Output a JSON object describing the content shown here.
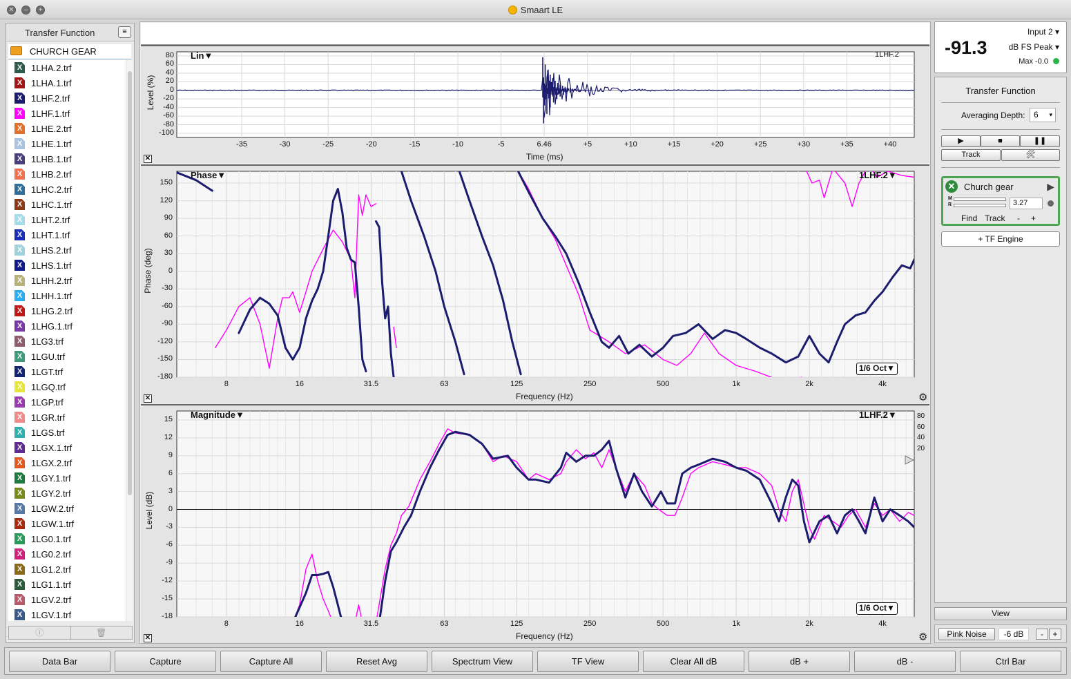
{
  "window": {
    "title": "Smaart LE"
  },
  "sidebar": {
    "title": "Transfer Function",
    "folder": "CHURCH GEAR",
    "files": [
      {
        "name": "1LHA.2.trf",
        "color": "#2e5a4a"
      },
      {
        "name": "1LHA.1.trf",
        "color": "#a31515"
      },
      {
        "name": "1LHF.2.trf",
        "color": "#1c1c6e"
      },
      {
        "name": "1LHF.1.trf",
        "color": "#ff00ff"
      },
      {
        "name": "1LHE.2.trf",
        "color": "#e0702a"
      },
      {
        "name": "1LHE.1.trf",
        "color": "#a8c4e0"
      },
      {
        "name": "1LHB.1.trf",
        "color": "#4a3e7a"
      },
      {
        "name": "1LHB.2.trf",
        "color": "#f07050"
      },
      {
        "name": "1LHC.2.trf",
        "color": "#2f6f9a"
      },
      {
        "name": "1LHC.1.trf",
        "color": "#8a3a16"
      },
      {
        "name": "1LHT.2.trf",
        "color": "#a4dbe8"
      },
      {
        "name": "1LHT.1.trf",
        "color": "#1a2fb8"
      },
      {
        "name": "1LHS.2.trf",
        "color": "#9fd2dc"
      },
      {
        "name": "1LHS.1.trf",
        "color": "#101a8a"
      },
      {
        "name": "1LHH.2.trf",
        "color": "#b9b27a"
      },
      {
        "name": "1LHH.1.trf",
        "color": "#2aaef0"
      },
      {
        "name": "1LHG.2.trf",
        "color": "#c01818"
      },
      {
        "name": "1LHG.1.trf",
        "color": "#7a3aa6"
      },
      {
        "name": "1LG3.trf",
        "color": "#8e5c6a"
      },
      {
        "name": "1LGU.trf",
        "color": "#3e9a78"
      },
      {
        "name": "1LGT.trf",
        "color": "#132472"
      },
      {
        "name": "1LGQ.trf",
        "color": "#e5e53a"
      },
      {
        "name": "1LGP.trf",
        "color": "#9a3ab0"
      },
      {
        "name": "1LGR.trf",
        "color": "#f08a8a"
      },
      {
        "name": "1LGS.trf",
        "color": "#2eb0ae"
      },
      {
        "name": "1LGX.1.trf",
        "color": "#5e2b8e"
      },
      {
        "name": "1LGX.2.trf",
        "color": "#e25a20"
      },
      {
        "name": "1LGY.1.trf",
        "color": "#1e7a3e"
      },
      {
        "name": "1LGY.2.trf",
        "color": "#7a8a1a"
      },
      {
        "name": "1LGW.2.trf",
        "color": "#5878a8"
      },
      {
        "name": "1LGW.1.trf",
        "color": "#a82a10"
      },
      {
        "name": "1LG0.1.trf",
        "color": "#2a9a5a"
      },
      {
        "name": "1LG0.2.trf",
        "color": "#d0207a"
      },
      {
        "name": "1LG1.2.trf",
        "color": "#8a6a1a"
      },
      {
        "name": "1LG1.1.trf",
        "color": "#2a5a3a"
      },
      {
        "name": "1LGV.2.trf",
        "color": "#b85a6a"
      },
      {
        "name": "1LGV.1.trf",
        "color": "#3a5a8a"
      }
    ]
  },
  "impulse": {
    "mode_label": "Lin▼",
    "trace_label": "1LHF.2",
    "ylabel": "Level (%)",
    "xlabel": "Time (ms)",
    "yticks": [
      "80",
      "60",
      "40",
      "20",
      "0",
      "-20",
      "-40",
      "-60",
      "-80",
      "-100"
    ],
    "xticks": [
      "-35",
      "-30",
      "-25",
      "-20",
      "-15",
      "-10",
      "-5",
      "6.46",
      "+5",
      "+10",
      "+15",
      "+20",
      "+25",
      "+30",
      "+35",
      "+40"
    ]
  },
  "phase": {
    "mode_label": "Phase▼",
    "trace_label": "1LHF.2▼",
    "ylabel": "Phase (deg)",
    "xlabel": "Frequency (Hz)",
    "smoothing": "1/6 Oct▼",
    "yticks": [
      "150",
      "120",
      "90",
      "60",
      "30",
      "0",
      "-30",
      "-60",
      "-90",
      "-120",
      "-150",
      "-180"
    ],
    "xticks": [
      "8",
      "16",
      "31.5",
      "63",
      "125",
      "250",
      "500",
      "1k",
      "2k",
      "4k"
    ]
  },
  "magnitude": {
    "mode_label": "Magnitude▼",
    "trace_label": "1LHF.2▼",
    "ylabel": "Level (dB)",
    "xlabel": "Frequency (Hz)",
    "smoothing": "1/6 Oct▼",
    "yticks": [
      "15",
      "12",
      "9",
      "6",
      "3",
      "0",
      "-3",
      "-6",
      "-9",
      "-12",
      "-15",
      "-18"
    ],
    "xticks": [
      "8",
      "16",
      "31.5",
      "63",
      "125",
      "250",
      "500",
      "1k",
      "2k",
      "4k"
    ],
    "coherence_ticks": [
      "80",
      "60",
      "40",
      "20"
    ]
  },
  "meter": {
    "value": "-91.3",
    "input": "Input 2",
    "scale": "dB FS Peak",
    "max": "Max -0.0"
  },
  "control": {
    "title": "Transfer Function",
    "avg_label": "Averaging Depth:",
    "avg_value": "6",
    "track_label": "Track",
    "measurement": {
      "name": "Church gear",
      "delay": "3.27",
      "find": "Find",
      "track": "Track",
      "minus": "-",
      "plus": "+",
      "m_label": "M",
      "r_label": "R"
    },
    "engine_label": "+ TF Engine"
  },
  "view_label": "View",
  "generator": {
    "label": "Pink Noise",
    "level": "-6 dB",
    "minus": "-",
    "plus": "+"
  },
  "bottom_buttons": [
    "Data Bar",
    "Capture",
    "Capture All",
    "Reset Avg",
    "Spectrum View",
    "TF View",
    "Clear All dB",
    "dB +",
    "dB -",
    "Ctrl Bar"
  ],
  "colors": {
    "primary_trace": "#1c1c6e",
    "secondary_trace": "#ff00ff",
    "active_green": "#4fa652"
  }
}
